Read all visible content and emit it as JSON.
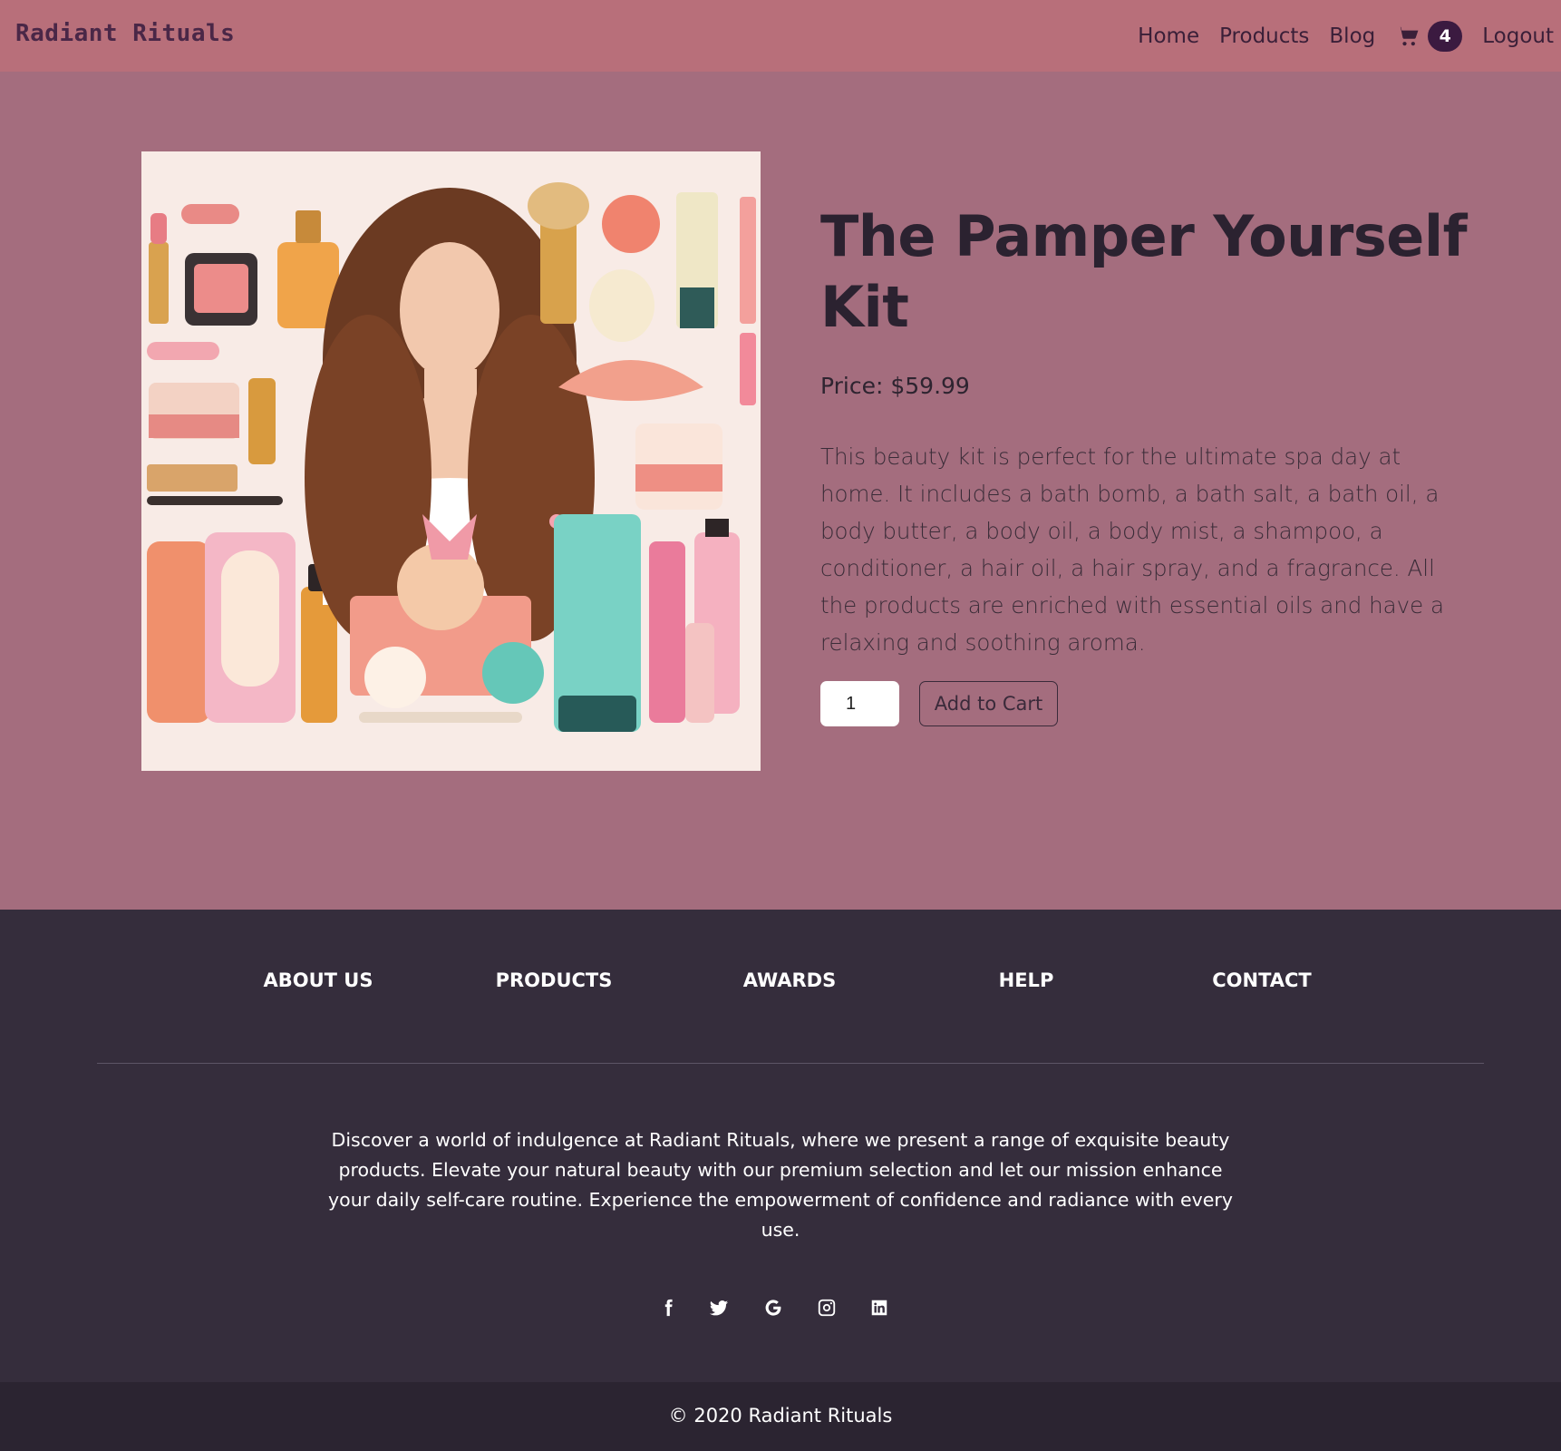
{
  "brand": "Radiant Rituals",
  "nav": {
    "home": "Home",
    "products": "Products",
    "blog": "Blog",
    "cart_icon": "shopping-cart-icon",
    "cart_count": "4",
    "logout": "Logout"
  },
  "product": {
    "title": "The Pamper Yourself Kit",
    "price": "Price: $59.99",
    "description": "This beauty kit is perfect for the ultimate spa day at home. It includes a bath bomb, a bath salt, a bath oil, a body butter, a body oil, a body mist, a shampoo, a conditioner, a hair oil, a hair spray, and a fragrance. All the products are enriched with essential oils and have a relaxing and soothing aroma.",
    "quantity": "1",
    "add_to_cart": "Add to Cart"
  },
  "footer": {
    "links": [
      "ABOUT US",
      "PRODUCTS",
      "AWARDS",
      "HELP",
      "CONTACT"
    ],
    "about": "Discover a world of indulgence at Radiant Rituals, where we present a range of exquisite beauty products. Elevate your natural beauty with our premium selection and let our mission enhance your daily self-care routine. Experience the empowerment of confidence and radiance with every use.",
    "social_icons": [
      "facebook-icon",
      "twitter-icon",
      "google-icon",
      "instagram-icon",
      "linkedin-icon"
    ],
    "copyright": "© 2020 Radiant Rituals"
  },
  "colors": {
    "navbar": "#b86f7a",
    "page_background": "#a46d7e",
    "footer": "#352d3c",
    "copyright_bar": "#2b2431",
    "badge": "#3b1a40"
  }
}
